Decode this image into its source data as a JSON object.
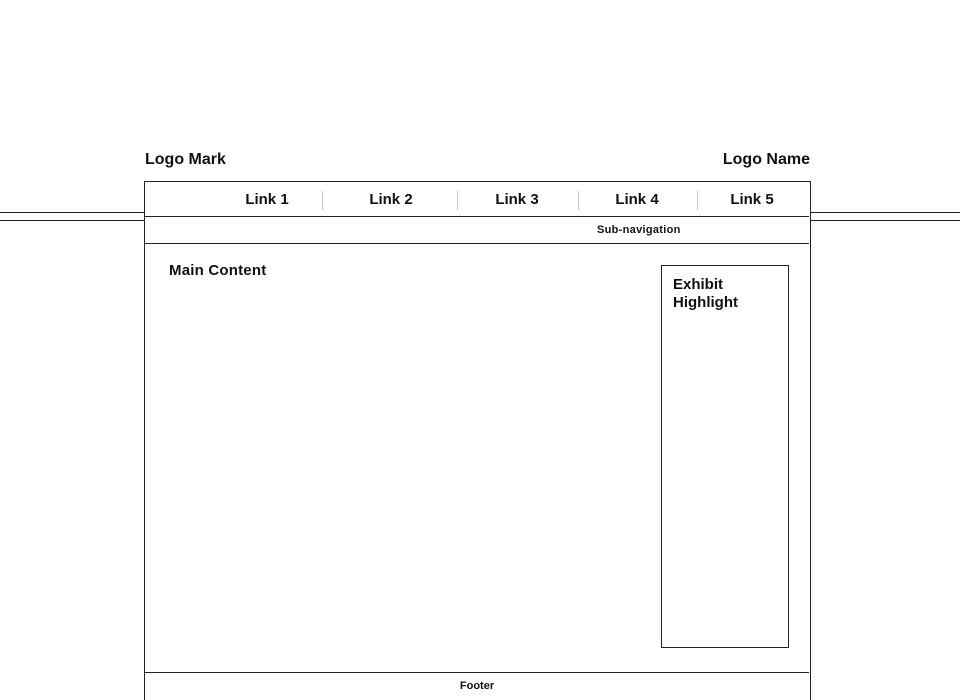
{
  "header": {
    "logo_mark": "Logo Mark",
    "logo_name": "Logo Name"
  },
  "nav": {
    "links": [
      {
        "label": "Link 1"
      },
      {
        "label": "Link 2"
      },
      {
        "label": "Link 3"
      },
      {
        "label": "Link 4"
      },
      {
        "label": "Link 5"
      }
    ]
  },
  "subnav": {
    "label": "Sub-navigation"
  },
  "main": {
    "title": "Main Content",
    "exhibit": {
      "title": "Exhibit Highlight"
    }
  },
  "footer": {
    "label": "Footer"
  }
}
